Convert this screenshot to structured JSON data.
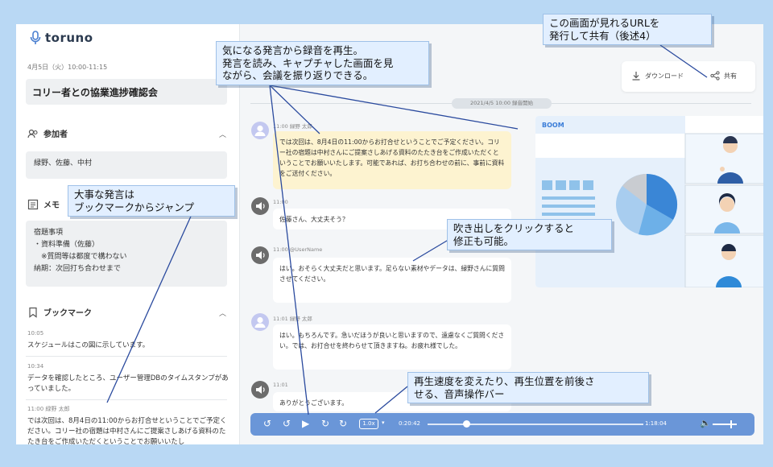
{
  "app": {
    "logo_text": "toruno"
  },
  "meeting": {
    "date": "4月5日（火）10:00-11:15",
    "title": "コリー者との協業進捗確認会"
  },
  "participants": {
    "heading": "参加者",
    "names": "緑野、佐藤、中村"
  },
  "memo": {
    "heading": "メモ",
    "lines": [
      "宿題事項",
      "・資料準備（佐藤）",
      "　※質問等は都度で構わない",
      "納期：次回打ち合わせまで"
    ]
  },
  "bookmarks": {
    "heading": "ブックマーク",
    "items": [
      {
        "time": "10:05",
        "text": "スケジュールはこの図に示しています。"
      },
      {
        "time": "10:34",
        "text": "データを確認したところ、ユーザー管理DBのタイムスタンプがあっていました。"
      },
      {
        "time": "11:00 緑野 太郎",
        "text": "では次回は、8月4日の11:00からお打合せということでご予定ください。コリー社の宿題は中村さんにご提案さしあげる資料のたたき台をご作成いただくということでお願いいたし"
      }
    ]
  },
  "toolbar": {
    "download_label": "ダウンロード",
    "share_label": "共有"
  },
  "timeline": {
    "marker": "2021/4/5  10:00  録音開始"
  },
  "transcript": [
    {
      "speaker": "11:00 緑野 太郎",
      "text": "では次回は、8月4日の11:00からお打合せということでご予定ください。コリー社の宿題は中村さんにご提案さしあげる資料のたたき台をご作成いただくということでお願いいたします。可能であれば、お打ち合わせの前に、事前に資料をご送付ください。"
    },
    {
      "speaker": "11:00",
      "text": "佐藤さん、大丈夫そう？"
    },
    {
      "speaker": "11:00 @UserName",
      "text": "はい。おそらく大丈夫だと思います。足らない素材やデータは、緑野さんに質問させてください。"
    },
    {
      "speaker": "11:01 緑野 太郎",
      "text": "はい。もちろんです。急いだほうが良いと思いますので、遠慮なくご質問ください。では、お打合せを終わらせて頂きますね。お疲れ様でした。"
    },
    {
      "speaker": "11:01",
      "text": "ありがとうございます。"
    }
  ],
  "video": {
    "label": "BOOM"
  },
  "player": {
    "rate": "1.0x",
    "current": "0:20:42",
    "total": "1:18:04",
    "progress": 0.18
  },
  "callouts": {
    "url_share": [
      "この画面が見れるURLを",
      "発行して共有（後述4）"
    ],
    "replay": [
      "気になる発言から録音を再生。",
      "発言を読み、キャプチャした画面を見",
      "ながら、会議を振り返りできる。"
    ],
    "bookmark": [
      "大事な発言は",
      "ブックマークからジャンプ"
    ],
    "edit": [
      "吹き出しをクリックすると",
      "修正も可能。"
    ],
    "audio": [
      "再生速度を変えたり、再生位置を前後さ",
      "せる、音声操作バー"
    ]
  },
  "colors": {
    "accent": "#6a96d8",
    "highlight": "#fdf3d0",
    "callout_bg": "#e2efff",
    "page_bg": "#b9d8f4"
  }
}
